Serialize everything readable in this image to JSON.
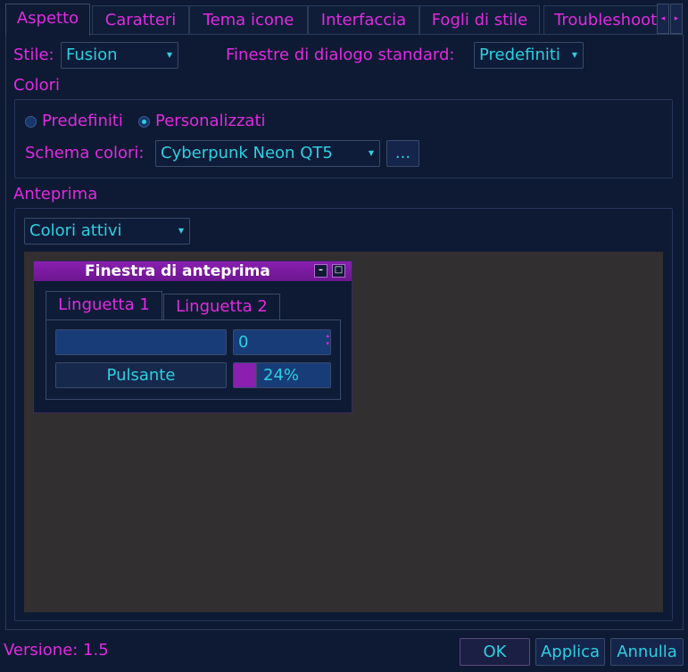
{
  "tabs": [
    "Aspetto",
    "Caratteri",
    "Tema icone",
    "Interfaccia",
    "Fogli di stile",
    "Troubleshoot"
  ],
  "tab_scroll": {
    "left": "◂",
    "right": "▸"
  },
  "style": {
    "label": "Stile:",
    "value": "Fusion"
  },
  "dialogs": {
    "label": "Finestre di dialogo standard:",
    "value": "Predefiniti"
  },
  "colors": {
    "group_label": "Colori",
    "radio_default": "Predefiniti",
    "radio_custom": "Personalizzati",
    "scheme_label": "Schema colori:",
    "scheme_value": "Cyberpunk Neon QT5",
    "more_button": "..."
  },
  "preview": {
    "group_label": "Anteprima",
    "mode_value": "Colori attivi",
    "window_title": "Finestra di anteprima",
    "tab1": "Linguetta 1",
    "tab2": "Linguetta 2",
    "spin_value": "0",
    "button_label": "Pulsante",
    "progress_text": "24%",
    "progress_fraction": 0.24
  },
  "footer": {
    "version": "Versione: 1.5",
    "ok": "OK",
    "apply": "Applica",
    "cancel": "Annulla"
  },
  "colors_theme": {
    "background": "#0e1a33",
    "accent_magenta": "#e02be0",
    "accent_cyan": "#2ecfe0",
    "title_purple": "#8a1fb0"
  }
}
